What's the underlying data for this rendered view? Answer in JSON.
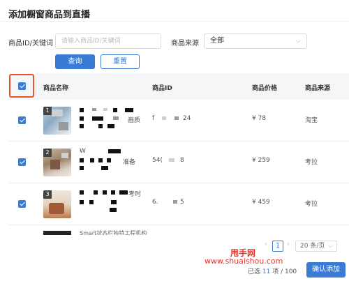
{
  "dialog": {
    "title": "添加橱窗商品到直播"
  },
  "filter": {
    "keyword_label": "商品ID/关键词",
    "keyword_placeholder": "请输入商品ID/关键词",
    "source_label": "商品来源",
    "source_value": "全部",
    "search_label": "查询",
    "reset_label": "重置"
  },
  "table": {
    "columns": [
      "商品名称",
      "商品ID",
      "商品价格",
      "商品来源"
    ],
    "rows": [
      {
        "index": "1",
        "title_tail": "画质",
        "id_prefix": "f",
        "id_suffix": "24",
        "price": "¥ 78",
        "source": "淘宝"
      },
      {
        "index": "2",
        "title_prefix": "W",
        "title_tail": "准备",
        "id_prefix": "54(",
        "id_suffix": "8",
        "price": "¥ 259",
        "source": "考拉"
      },
      {
        "index": "3",
        "title_tail": "考时",
        "id_prefix": "6.",
        "id_suffix": "5",
        "price": "¥ 459",
        "source": "考拉"
      }
    ],
    "partial_row_text": "Smart状态栏独特工程机构"
  },
  "pagination": {
    "prev": "‹",
    "current": "1",
    "next": "›",
    "page_size": "20 条/页"
  },
  "footer": {
    "selected_prefix": "已选",
    "selected_count": "11",
    "selected_suffix": "项 / 100",
    "confirm_label": "确认添加"
  },
  "watermark": {
    "line1": "甩手网",
    "line2": "www.shuaishou.com"
  },
  "colors": {
    "accent": "#3a7bd5",
    "highlight": "#e0592a",
    "watermark": "#e8332c"
  }
}
